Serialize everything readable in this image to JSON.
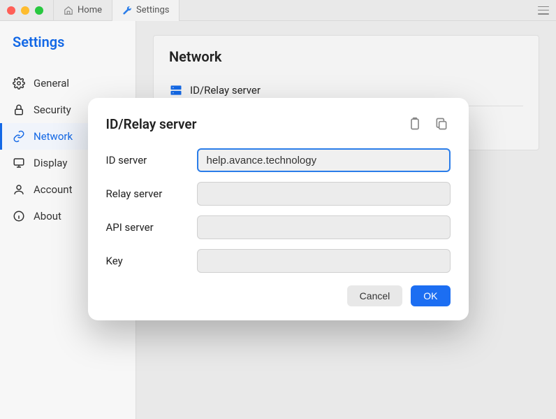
{
  "titlebar": {
    "tabs": [
      {
        "label": "Home"
      },
      {
        "label": "Settings"
      }
    ]
  },
  "sidebar": {
    "title": "Settings",
    "items": [
      {
        "label": "General"
      },
      {
        "label": "Security"
      },
      {
        "label": "Network"
      },
      {
        "label": "Display"
      },
      {
        "label": "Account"
      },
      {
        "label": "About"
      }
    ]
  },
  "content": {
    "card_title": "Network",
    "section_label": "ID/Relay server"
  },
  "dialog": {
    "title": "ID/Relay server",
    "fields": {
      "id_server": {
        "label": "ID server",
        "value": "help.avance.technology"
      },
      "relay_server": {
        "label": "Relay server",
        "value": ""
      },
      "api_server": {
        "label": "API server",
        "value": ""
      },
      "key": {
        "label": "Key",
        "value": ""
      }
    },
    "buttons": {
      "cancel": "Cancel",
      "ok": "OK"
    }
  }
}
